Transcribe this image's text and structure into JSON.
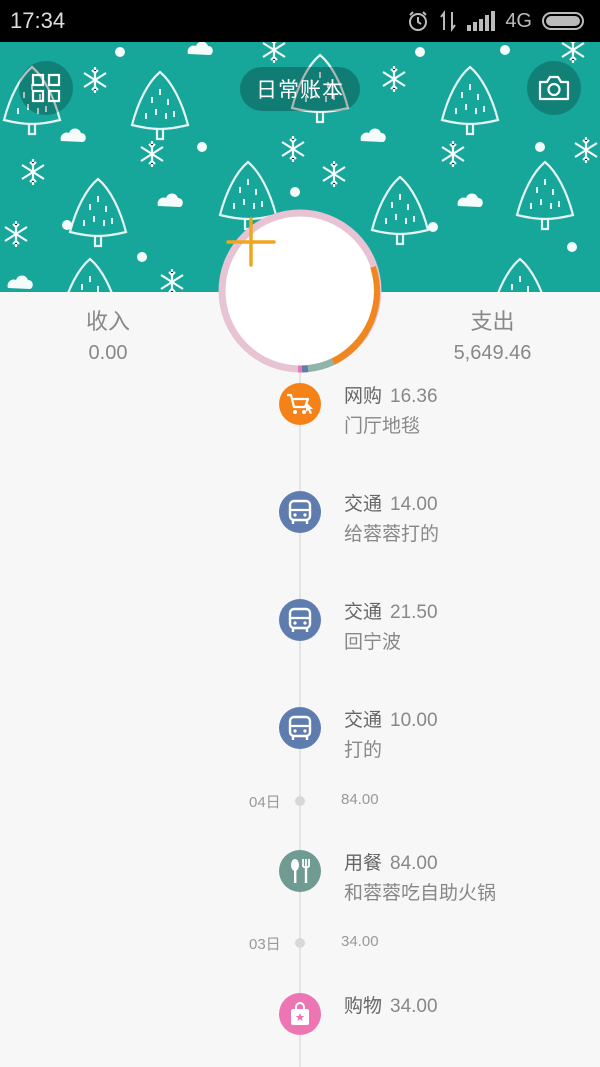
{
  "status_bar": {
    "time": "17:34",
    "network": "4G"
  },
  "header": {
    "book_name": "日常账本"
  },
  "summary": {
    "income_label": "收入",
    "income_value": "0.00",
    "expense_label": "支出",
    "expense_value": "5,649.46"
  },
  "colors": {
    "header_bg": "#17a69a",
    "add_plus": "#f0a51f",
    "online_shopping": "#f58218",
    "transport": "#5f7cae",
    "dining": "#6f9b93",
    "shopping": "#ee75b4"
  },
  "entries": [
    {
      "category": "网购",
      "amount": "16.36",
      "note": "门厅地毯",
      "icon": "cart-icon"
    },
    {
      "category": "交通",
      "amount": "14.00",
      "note": "给蓉蓉打的",
      "icon": "bus-icon"
    },
    {
      "category": "交通",
      "amount": "21.50",
      "note": "回宁波",
      "icon": "bus-icon"
    },
    {
      "category": "交通",
      "amount": "10.00",
      "note": "打的",
      "icon": "bus-icon"
    },
    {
      "category": "用餐",
      "amount": "84.00",
      "note": "和蓉蓉吃自助火锅",
      "icon": "utensils-icon"
    },
    {
      "category": "购物",
      "amount": "34.00",
      "note": "",
      "icon": "bag-icon"
    }
  ],
  "days": [
    {
      "date": "04日",
      "total": "84.00"
    },
    {
      "date": "03日",
      "total": "34.00"
    }
  ]
}
